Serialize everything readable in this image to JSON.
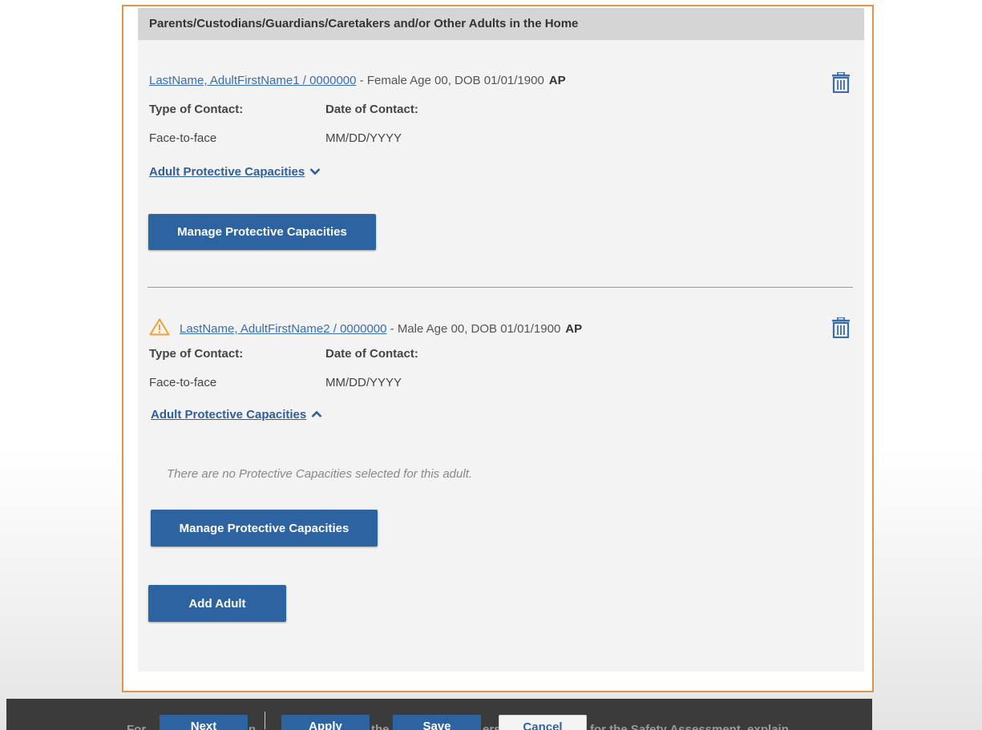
{
  "section": {
    "title": "Parents/Custodians/Guardians/Caretakers and/or Other Adults in the Home"
  },
  "adults": [
    {
      "link_text": "LastName, AdultFirstName1 / 0000000",
      "details": " - Female Age 00, DOB 01/01/1900",
      "role": "AP",
      "type_of_contact_label": "Type of Contact:",
      "date_of_contact_label": "Date of Contact:",
      "type_of_contact_value": "Face-to-face",
      "date_of_contact_value": "MM/DD/YYYY",
      "capacities_toggle": "Adult Protective Capacities",
      "capacities_expanded": false,
      "manage_button": "Manage Protective Capacities",
      "has_warning": false
    },
    {
      "link_text": "LastName, AdultFirstName2 / 0000000",
      "details": " - Male Age 00, DOB 01/01/1900",
      "role": "AP",
      "type_of_contact_label": "Type of Contact:",
      "date_of_contact_label": "Date of Contact:",
      "type_of_contact_value": "Face-to-face",
      "date_of_contact_value": "MM/DD/YYYY",
      "capacities_toggle": "Adult Protective Capacities",
      "capacities_expanded": true,
      "empty_message": "There are no Protective Capacities selected for this adult.",
      "manage_button": "Manage Protective Capacities",
      "has_warning": true
    }
  ],
  "add_adult_button": "Add Adult",
  "footer": {
    "background_text_left": "For",
    "background_text_mid1": "n",
    "background_text_mid2": "the",
    "background_text_mid3": "ers",
    "background_text_right": "for the Safety Assessment, explain",
    "next_label": "Next",
    "apply_label": "Apply",
    "save_label": "Save",
    "cancel_label": "Cancel"
  },
  "colors": {
    "accent": "#2c63a0",
    "link": "#3a6ea8",
    "frame_border": "#d9954a",
    "warning": "#f0a030",
    "panel_bg": "#f3f3f3",
    "header_bg": "#d5d5d5"
  },
  "icons": {
    "trash": "trash-icon",
    "warning": "warning-triangle-icon",
    "chevron_down": "chevron-down-icon",
    "chevron_up": "chevron-up-icon"
  }
}
